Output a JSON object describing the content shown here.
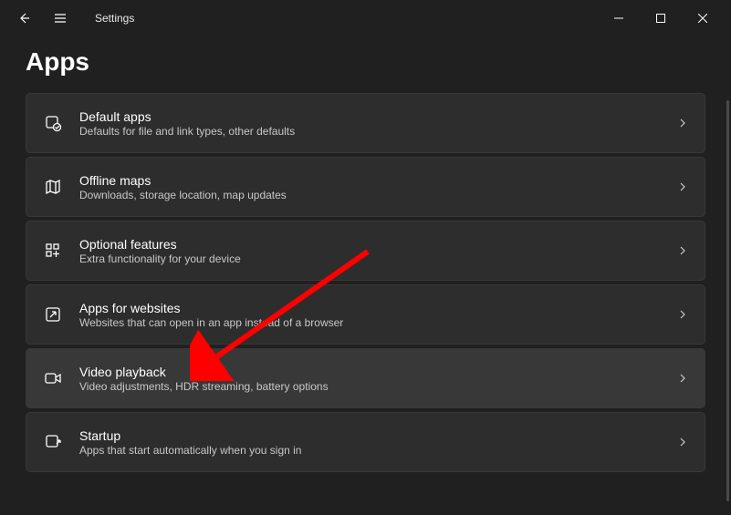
{
  "window": {
    "title": "Settings"
  },
  "page": {
    "heading": "Apps"
  },
  "items": [
    {
      "title": "Default apps",
      "subtitle": "Defaults for file and link types, other defaults",
      "icon": "default-apps-icon"
    },
    {
      "title": "Offline maps",
      "subtitle": "Downloads, storage location, map updates",
      "icon": "offline-maps-icon"
    },
    {
      "title": "Optional features",
      "subtitle": "Extra functionality for your device",
      "icon": "optional-features-icon"
    },
    {
      "title": "Apps for websites",
      "subtitle": "Websites that can open in an app instead of a browser",
      "icon": "apps-websites-icon"
    },
    {
      "title": "Video playback",
      "subtitle": "Video adjustments, HDR streaming, battery options",
      "icon": "video-playback-icon",
      "highlighted": true
    },
    {
      "title": "Startup",
      "subtitle": "Apps that start automatically when you sign in",
      "icon": "startup-icon"
    }
  ],
  "annotation": {
    "type": "arrow",
    "target": "Video playback"
  }
}
